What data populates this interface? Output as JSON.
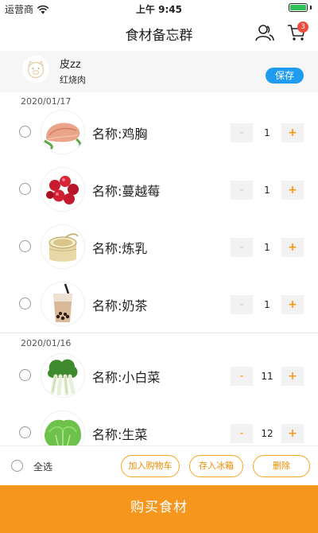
{
  "status_bar": {
    "carrier": "运营商",
    "time": "上午 9:45",
    "battery_color": "#2ec15a"
  },
  "nav": {
    "title": "食材备忘群",
    "user_icon": "user-icon",
    "cart_icon": "cart-icon",
    "cart_badge": "3"
  },
  "user_card": {
    "name": "皮zz",
    "dish": "红烧肉",
    "save_label": "保存"
  },
  "groups": [
    {
      "date": "2020/01/17",
      "items": [
        {
          "name": "名称:鸡胸",
          "qty": "1",
          "minus": "-",
          "plus": "+",
          "image": "chicken-breast-image"
        },
        {
          "name": "名称:蔓越莓",
          "qty": "1",
          "minus": "-",
          "plus": "+",
          "image": "cranberry-image"
        },
        {
          "name": "名称:炼乳",
          "qty": "1",
          "minus": "-",
          "plus": "+",
          "image": "condensed-milk-image"
        },
        {
          "name": "名称:奶茶",
          "qty": "1",
          "minus": "-",
          "plus": "+",
          "image": "milk-tea-image"
        }
      ]
    },
    {
      "date": "2020/01/16",
      "items": [
        {
          "name": "名称:小白菜",
          "qty": "11",
          "minus": "-",
          "plus": "+",
          "image": "bok-choy-image"
        },
        {
          "name": "名称:生菜",
          "qty": "12",
          "minus": "-",
          "plus": "+",
          "image": "lettuce-image"
        }
      ]
    }
  ],
  "action_bar": {
    "select_all": "全选",
    "add_cart": "加入购物车",
    "to_fridge": "存入冰箱",
    "delete": "删除"
  },
  "buy_button": "购买食材",
  "colors": {
    "accent": "#f7961d",
    "save_blue": "#1f9bf0",
    "badge_red": "#f04a3c"
  }
}
